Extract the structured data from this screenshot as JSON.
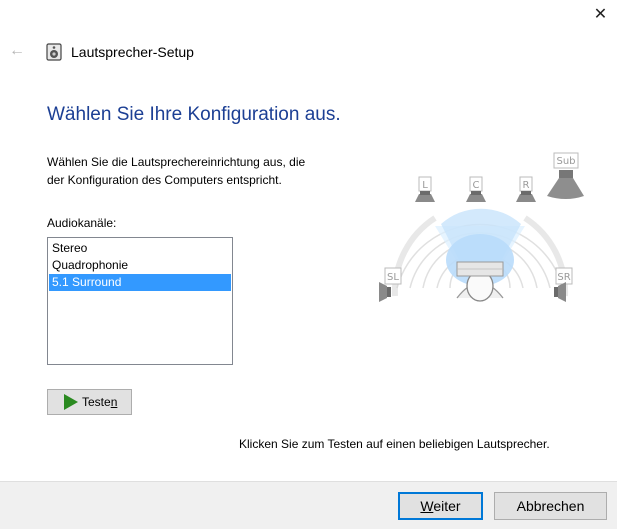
{
  "window": {
    "title": "Lautsprecher-Setup",
    "close_glyph": "✕",
    "back_glyph": "←",
    "icons": {
      "close": "close-icon",
      "back": "back-arrow-icon",
      "app": "speaker-app-icon"
    }
  },
  "page": {
    "heading": "Wählen Sie Ihre Konfiguration aus.",
    "description_line1": "Wählen Sie die Lautsprechereinrichtung aus, die",
    "description_line2": "der Konfiguration des Computers entspricht.",
    "audio_channels_label": "Audiokanäle:",
    "channels": [
      {
        "label": "Stereo",
        "selected": false
      },
      {
        "label": "Quadrophonie",
        "selected": false
      },
      {
        "label": "5.1 Surround",
        "selected": true
      }
    ],
    "test_button": {
      "label_pre": "Teste",
      "label_accel": "n",
      "icon": "play-icon"
    },
    "hint": "Klicken Sie zum Testen auf einen beliebigen Lautsprecher."
  },
  "speaker_diagram": {
    "speakers": {
      "front_left": "L",
      "center": "C",
      "front_right": "R",
      "subwoofer": "Sub",
      "surround_left": "SL",
      "surround_right": "SR"
    }
  },
  "footer": {
    "next": {
      "label_accel": "W",
      "label_rest": "eiter"
    },
    "cancel": "Abbrechen"
  },
  "colors": {
    "heading": "#1c3f94",
    "selection": "#3399ff",
    "default_button_border": "#0078d7",
    "play_icon": "#2a8a20"
  }
}
